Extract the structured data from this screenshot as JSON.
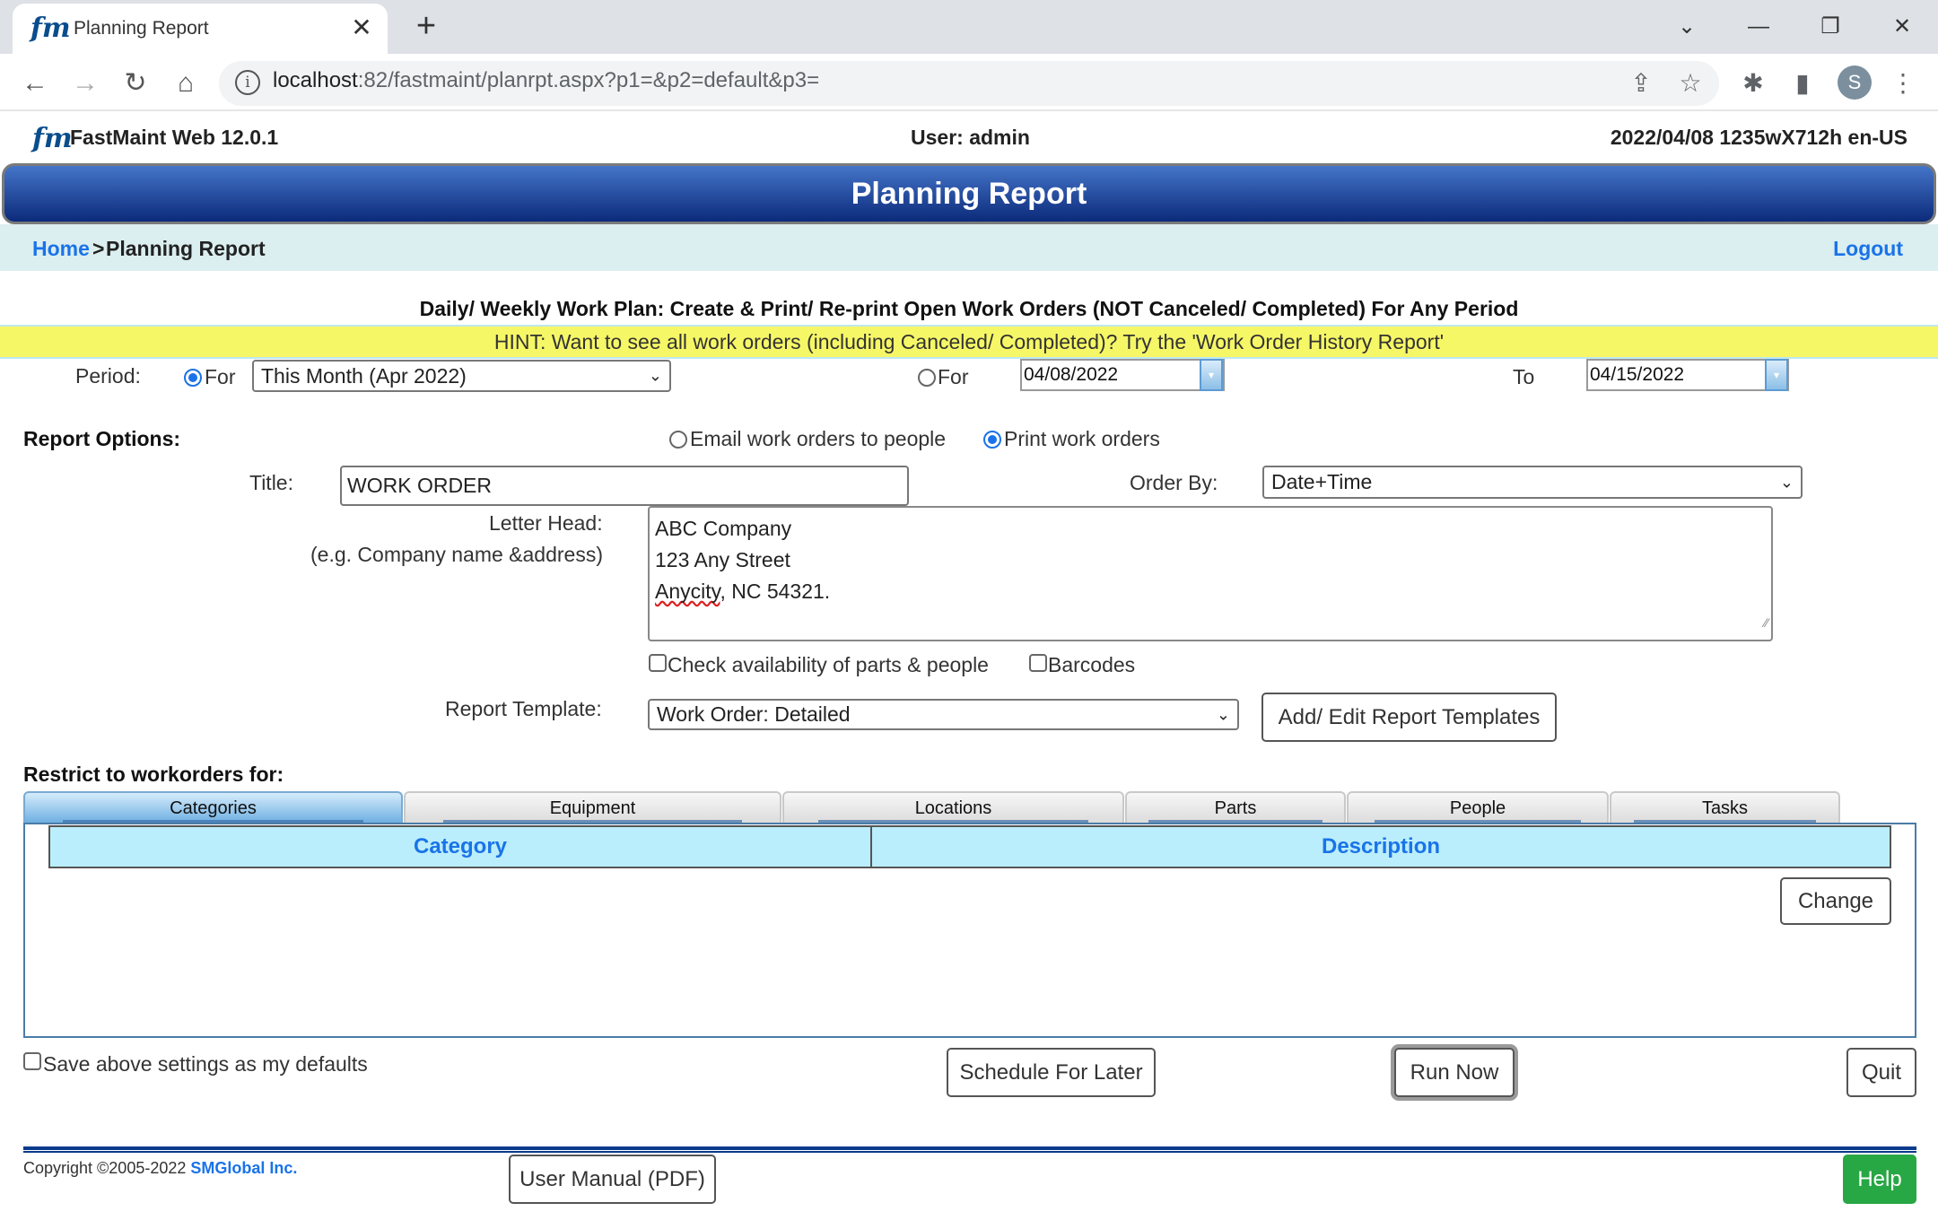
{
  "browser": {
    "tab_title": "Planning Report",
    "tab_favicon": "fm",
    "url_host": "localhost",
    "url_rest": ":82/fastmaint/planrpt.aspx?p1=&p2=default&p3=",
    "profile_initial": "S",
    "icons": {
      "close": "✕",
      "new_tab": "+",
      "tab_search": "⌄",
      "minimize": "—",
      "restore": "❐",
      "window_close": "✕",
      "back": "←",
      "forward": "→",
      "reload": "↻",
      "home": "⌂",
      "info": "i",
      "share": "⇪",
      "bookmark": "☆",
      "extensions": "✱",
      "side_panel": "▮",
      "menu": "⋮"
    }
  },
  "header": {
    "logo": "fm",
    "app_name": "FastMaint Web 12.0.1",
    "user": "User: admin",
    "sysinfo": "2022/04/08 1235wX712h en-US",
    "banner_title": "Planning Report"
  },
  "breadcrumb": {
    "home": "Home",
    "separator": ">",
    "current": "Planning Report",
    "logout": "Logout"
  },
  "subtitle": "Daily/ Weekly Work Plan: Create & Print/ Re-print Open Work Orders (NOT Canceled/ Completed) For Any Period",
  "hint": "HINT: Want to see all work orders (including Canceled/ Completed)? Try the 'Work Order History Report'",
  "period": {
    "label": "Period:",
    "option_for_preset": {
      "label": "For",
      "checked": true
    },
    "preset_value": "This Month (Apr 2022)",
    "option_for_range": {
      "label": "For",
      "checked": false
    },
    "from_date": "04/08/2022",
    "to_label": "To",
    "to_date": "04/15/2022"
  },
  "report_options": {
    "heading": "Report Options:",
    "email_option": {
      "label": "Email work orders to people",
      "checked": false
    },
    "print_option": {
      "label": "Print work orders",
      "checked": true
    },
    "title_label": "Title:",
    "title_value": "WORK ORDER",
    "order_by_label": "Order By:",
    "order_by_value": "Date+Time",
    "letterhead_label": "Letter Head:",
    "letterhead_hint": "(e.g. Company name &address)",
    "letterhead_lines": [
      "ABC Company",
      "123 Any Street",
      "Anycity",
      ", NC 54321."
    ],
    "check_availability": {
      "label": "Check availability of parts & people",
      "checked": false
    },
    "barcodes": {
      "label": "Barcodes",
      "checked": false
    },
    "template_label": "Report Template:",
    "template_value": "Work Order: Detailed",
    "edit_templates_button": "Add/ Edit Report Templates"
  },
  "restrict": {
    "heading": "Restrict to workorders for:",
    "tabs": [
      {
        "label": "Categories",
        "active": true
      },
      {
        "label": "Equipment",
        "active": false
      },
      {
        "label": "Locations",
        "active": false
      },
      {
        "label": "Parts",
        "active": false
      },
      {
        "label": "People",
        "active": false
      },
      {
        "label": "Tasks",
        "active": false
      }
    ],
    "columns": [
      "Category",
      "Description"
    ],
    "rows": [],
    "change_button": "Change"
  },
  "actions": {
    "save_defaults": {
      "label": "Save above settings as my defaults",
      "checked": false
    },
    "schedule_button": "Schedule For Later",
    "run_button": "Run Now",
    "quit_button": "Quit"
  },
  "footer": {
    "copyright": "Copyright ©2005-2022 ",
    "company": "SMGlobal Inc.",
    "manual_button": "User Manual (PDF)",
    "help_button": "Help"
  },
  "colors": {
    "banner_top": "#4475c9",
    "banner_bottom": "#0c2a7a",
    "link": "#1a73e8",
    "hint_bg": "#f6f766",
    "grid_header_bg": "#bbeefc",
    "help_green": "#28a745"
  }
}
